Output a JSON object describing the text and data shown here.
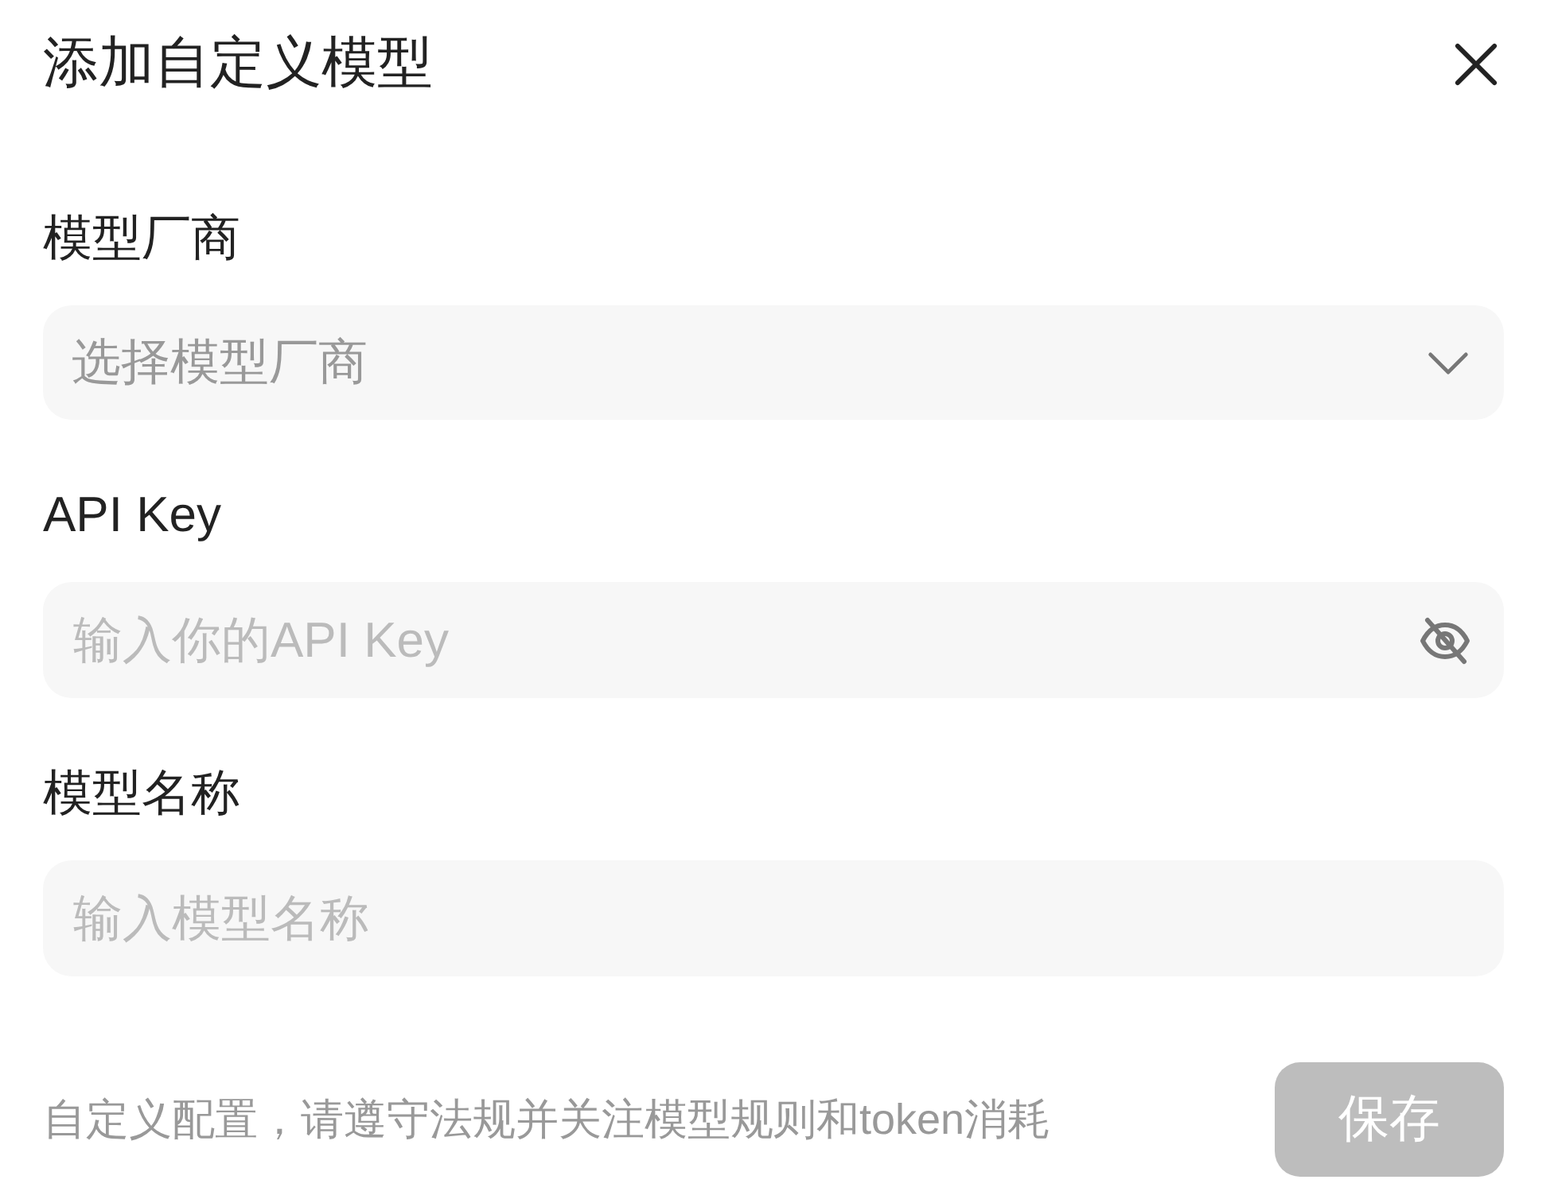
{
  "dialog": {
    "title": "添加自定义模型"
  },
  "fields": [
    {
      "kind": "select",
      "label": "模型厂商",
      "placeholder": "选择模型厂商"
    },
    {
      "kind": "password",
      "label": "API Key",
      "placeholder": "输入你的API Key",
      "revealed": false
    },
    {
      "kind": "text",
      "label": "模型名称",
      "placeholder": "输入模型名称"
    }
  ],
  "footer": {
    "note": "自定义配置，请遵守法规并关注模型规则和token消耗",
    "save_button": {
      "label": "保存",
      "disabled": true
    }
  }
}
